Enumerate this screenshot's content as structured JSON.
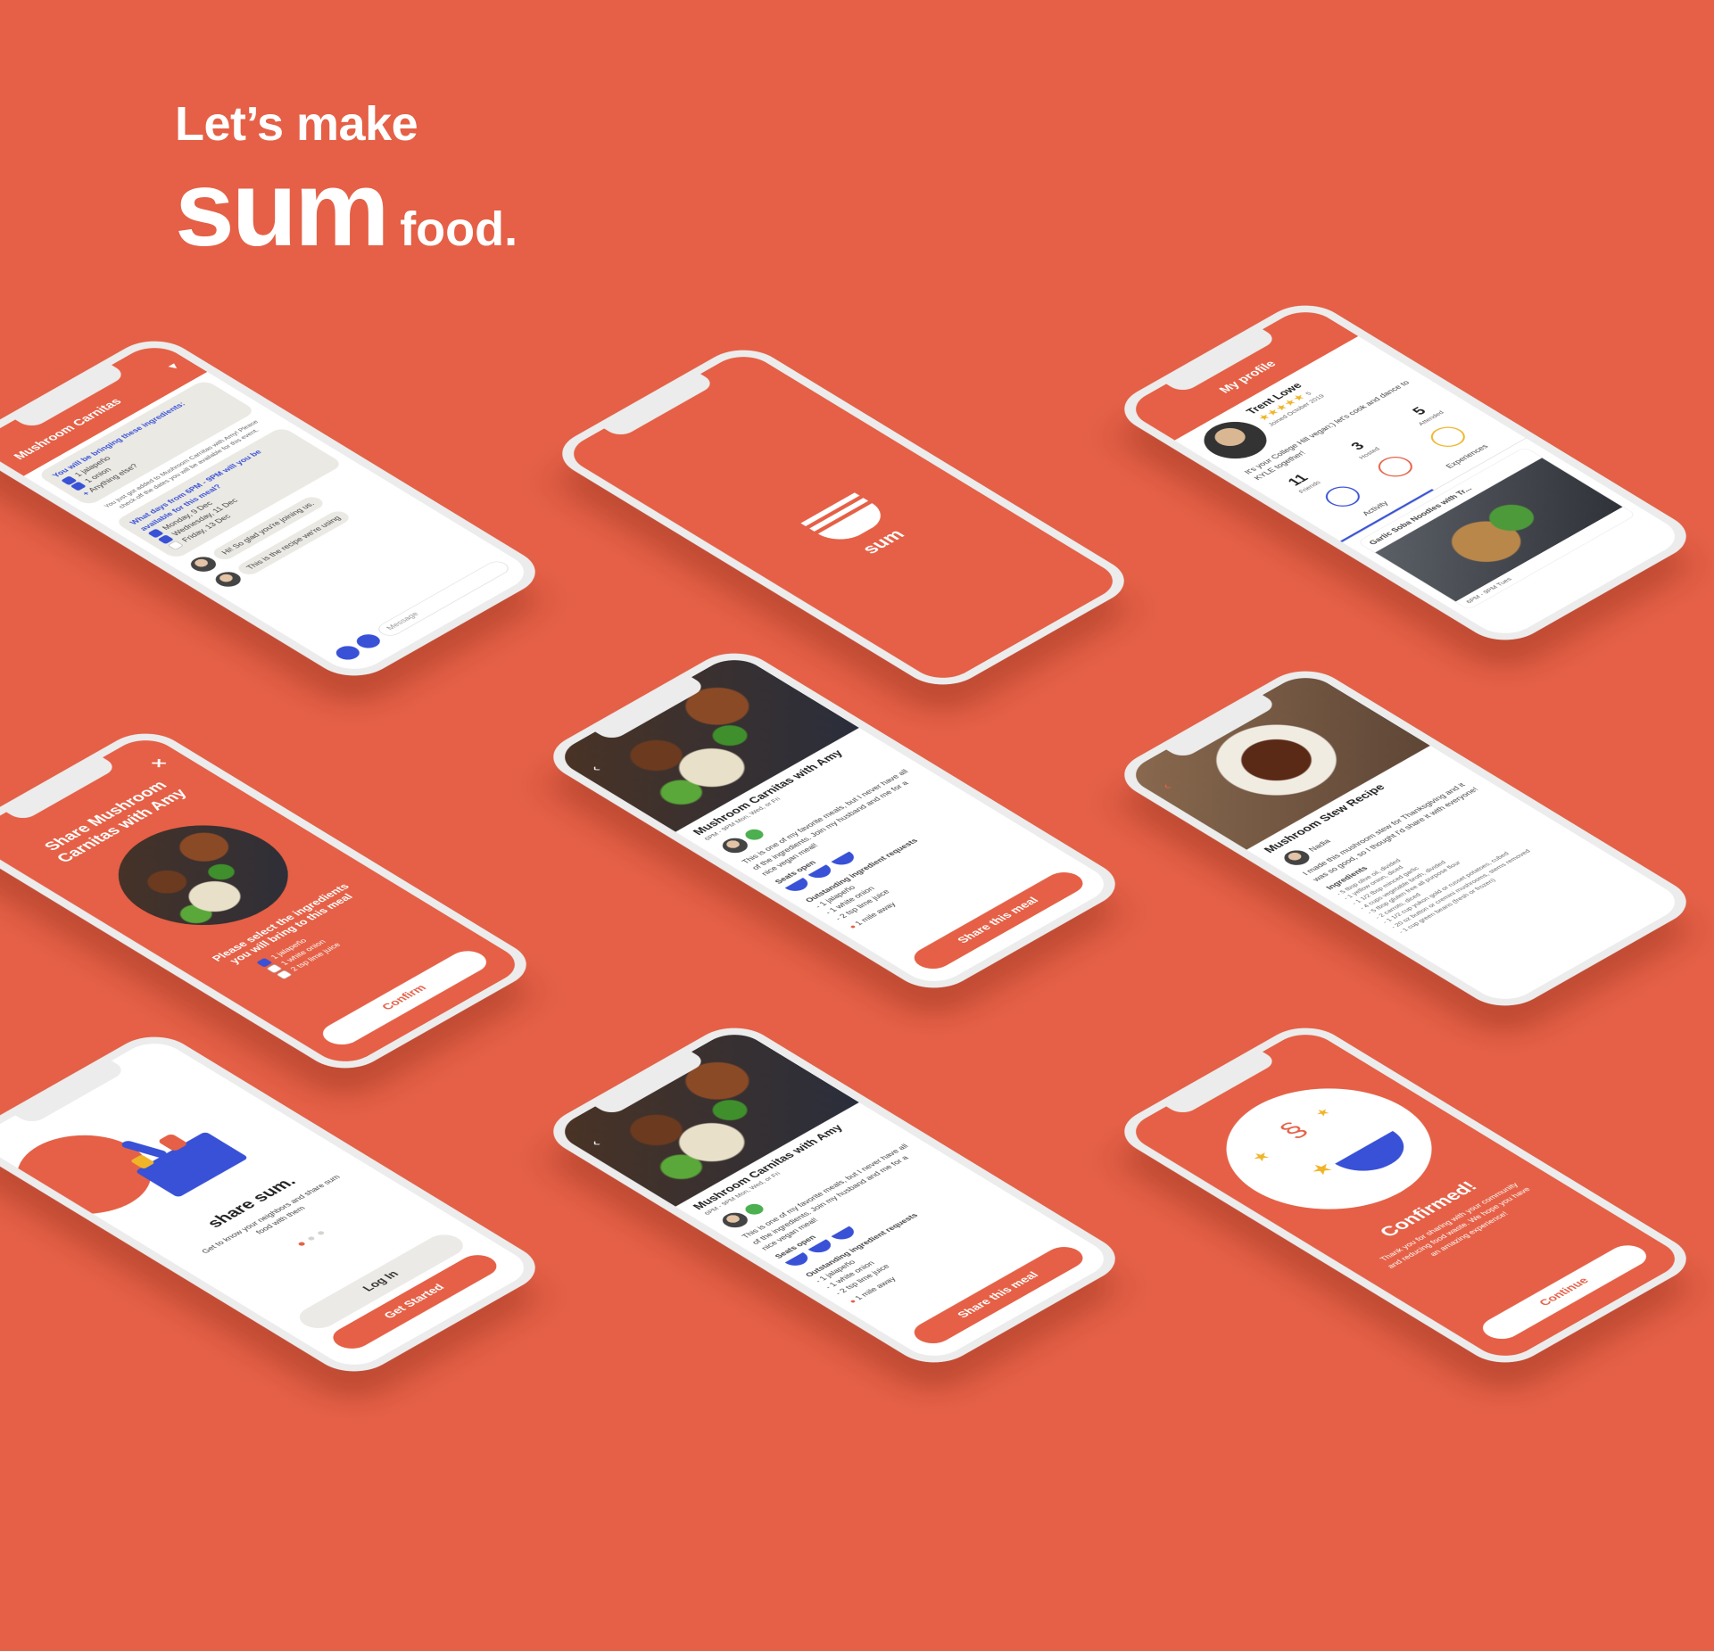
{
  "hero": {
    "line1": "Let’s make",
    "brand": "sum",
    "suffix": "food."
  },
  "colors": {
    "brand": "#e56046",
    "accent": "#3851d6",
    "white": "#ffffff"
  },
  "splash": {
    "logo_label": "sum"
  },
  "chat": {
    "title": "Mushroom Carnitas",
    "bring_heading": "You will be bringing these ingredients:",
    "ingredients": [
      "1 jalapeño",
      "1 onion"
    ],
    "anything_else": "Anything else?",
    "note": "You just got added to Mushroom Carnitas with Amy! Please check off the dates you will be available for this event.",
    "days_question": "What days from 6PM - 9PM will you be available for this meal?",
    "days": [
      "Monday, 9 Dec",
      "Wednesday, 11 Dec",
      "Friday, 13 Dec"
    ],
    "msg1": "Hi! So glad you're joining us.",
    "msg2": "This is the recipe we're using",
    "message_placeholder": "Message"
  },
  "profile": {
    "header": "My profile",
    "name": "Trent Lowe",
    "rating": "5",
    "joined": "Joined October 2019",
    "bio": "It's your College Hill vegan:) let's cook and dance to KYLE together!",
    "stats": [
      {
        "value": "11",
        "label": "Friends"
      },
      {
        "value": "3",
        "label": "Hosted"
      },
      {
        "value": "5",
        "label": "Attended"
      }
    ],
    "tabs": [
      "Activity",
      "Experiences"
    ],
    "card_title": "Garlic Soba Noodles with Tr...",
    "card_meta": "6PM - 9PM Tues"
  },
  "share_select": {
    "title": "Share Mushroom Carnitas with Amy",
    "prompt": "Please select the ingredients you will bring to this meal",
    "options": [
      "1 jalapeño",
      "1 white onion",
      "2 tsp lime juice"
    ],
    "confirm": "Confirm"
  },
  "meal": {
    "title": "Mushroom Carnitas with Amy",
    "time": "6PM - 9PM Mon, Wed, or Fri",
    "description": "This is one of my favorite meals, but I never have all of the ingredients. Join my husband and me for a nice vegan meal!",
    "seats_label": "Seats open",
    "requests_heading": "Outstanding ingredient requests",
    "requests": [
      "1 jalapeño",
      "1 white onion",
      "2 tsp lime juice"
    ],
    "distance": "1 mile away",
    "cta": "Share this meal"
  },
  "recipe": {
    "title": "Mushroom Stew Recipe",
    "author": "Nadia",
    "intro": "I made this mushroom stew for Thanksgiving and it was so good, so I thought I'd share it with everyone!",
    "ingredients_heading": "Ingredients",
    "ingredients": [
      "5 tbsp olive oil, divided",
      "1 yellow onion, diced",
      "1 1/2 tbsp minced garlic",
      "4 cups vegetable broth, divided",
      "5 tbsp gluten free all purpose flour",
      "2 carrots, diced",
      "1 1/2 cup yukon gold or russet potatoes, cubed",
      "20 oz button or cremini mushrooms, stems removed",
      "1 cup green beans (fresh or frozen)"
    ]
  },
  "welcome": {
    "title": "share sum.",
    "subtitle": "Get to know your neighbors and share sum food with them",
    "login": "Log In",
    "get_started": "Get Started"
  },
  "confirmed": {
    "title": "Confirmed!",
    "body": "Thank you for sharing with your community and reducing food waste. We hope you have an amazing experience!",
    "cta": "Continue"
  }
}
